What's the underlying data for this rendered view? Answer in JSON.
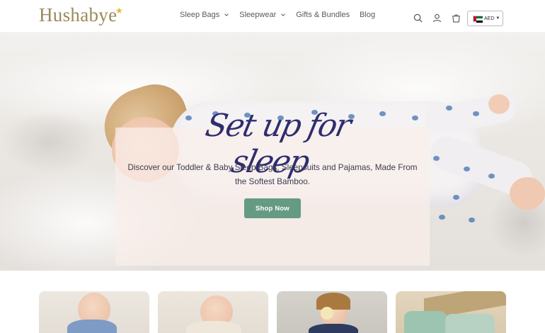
{
  "brand": {
    "logo_text": "Hushabye",
    "accent_color": "#9a8a5a",
    "star_color": "#e2b53a"
  },
  "nav": {
    "items": [
      {
        "label": "Sleep Bags",
        "has_dropdown": true
      },
      {
        "label": "Sleepwear",
        "has_dropdown": true
      },
      {
        "label": "Gifts & Bundles",
        "has_dropdown": false
      },
      {
        "label": "Blog",
        "has_dropdown": false
      }
    ]
  },
  "header_icons": [
    "search-icon",
    "account-icon",
    "cart-icon"
  ],
  "currency": {
    "code": "AED",
    "flag": "uae-flag-icon"
  },
  "hero": {
    "title": "Set up for sleep",
    "subtitle": "Discover our Toddler & Baby Sleep Bags, Sleepsuits and Pajamas, Made From the Softest Bamboo.",
    "cta_label": "Shop Now",
    "cta_color": "#659a83",
    "title_color": "#2f2d6e"
  },
  "product_cards": [
    {
      "name": "card-1"
    },
    {
      "name": "card-2"
    },
    {
      "name": "card-3"
    },
    {
      "name": "card-4"
    }
  ]
}
